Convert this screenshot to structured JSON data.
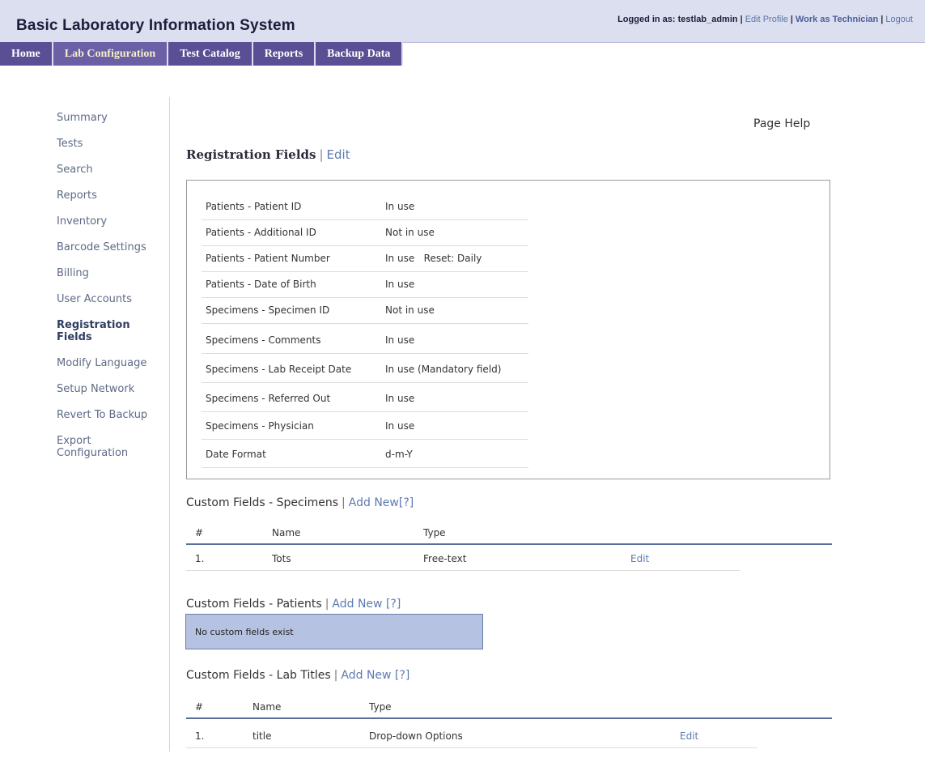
{
  "app": {
    "title": "Basic Laboratory Information System",
    "logged_in_label": "Logged in as: testlab_admin",
    "links": [
      "Edit Profile",
      "Work as Technician",
      "Logout"
    ]
  },
  "tabs": [
    "Home",
    "Lab Configuration",
    "Test Catalog",
    "Reports",
    "Backup Data"
  ],
  "active_tab": "Lab Configuration",
  "sidebar": {
    "items": [
      "Summary",
      "Tests",
      "Search",
      "Reports",
      "Inventory",
      "Barcode Settings",
      "Billing",
      "User Accounts",
      "Registration Fields",
      "Modify Language",
      "Setup Network",
      "Revert To Backup",
      "Export Configuration"
    ],
    "active": "Registration Fields"
  },
  "page_help": "Page Help",
  "registration": {
    "title": "Registration Fields",
    "edit_label": "Edit",
    "rows": [
      {
        "field": "Patients - Patient ID",
        "status": "In use"
      },
      {
        "field": "Patients - Additional ID",
        "status": "Not in use"
      },
      {
        "field": "Patients - Patient Number",
        "status": "In use   Reset: Daily"
      },
      {
        "field": "Patients - Date of Birth",
        "status": "In use"
      },
      {
        "field": "Specimens - Specimen ID",
        "status": "Not in use"
      },
      {
        "field": "Specimens - Comments",
        "status": "In use"
      },
      {
        "field": "Specimens - Lab Receipt Date",
        "status": "In use (Mandatory field)"
      },
      {
        "field": "Specimens - Referred Out",
        "status": "In use"
      },
      {
        "field": "Specimens - Physician",
        "status": "In use"
      },
      {
        "field": "Date Format",
        "status": "d-m-Y"
      }
    ]
  },
  "custom_specimens": {
    "title": "Custom Fields - Specimens",
    "add_label": "Add New[?]",
    "columns": [
      "#",
      "Name",
      "Type"
    ],
    "rows": [
      {
        "num": "1.",
        "name": "Tots",
        "type": "Free-text",
        "action": "Edit"
      }
    ]
  },
  "custom_patients": {
    "title": "Custom Fields - Patients",
    "add_label": "Add New [?]",
    "empty_message": "No custom fields exist"
  },
  "custom_lab_titles": {
    "title": "Custom Fields - Lab Titles",
    "add_label": "Add New [?]",
    "columns": [
      "#",
      "Name",
      "Type"
    ],
    "rows": [
      {
        "num": "1.",
        "name": "title",
        "type": "Drop-down Options",
        "action": "Edit"
      }
    ]
  }
}
